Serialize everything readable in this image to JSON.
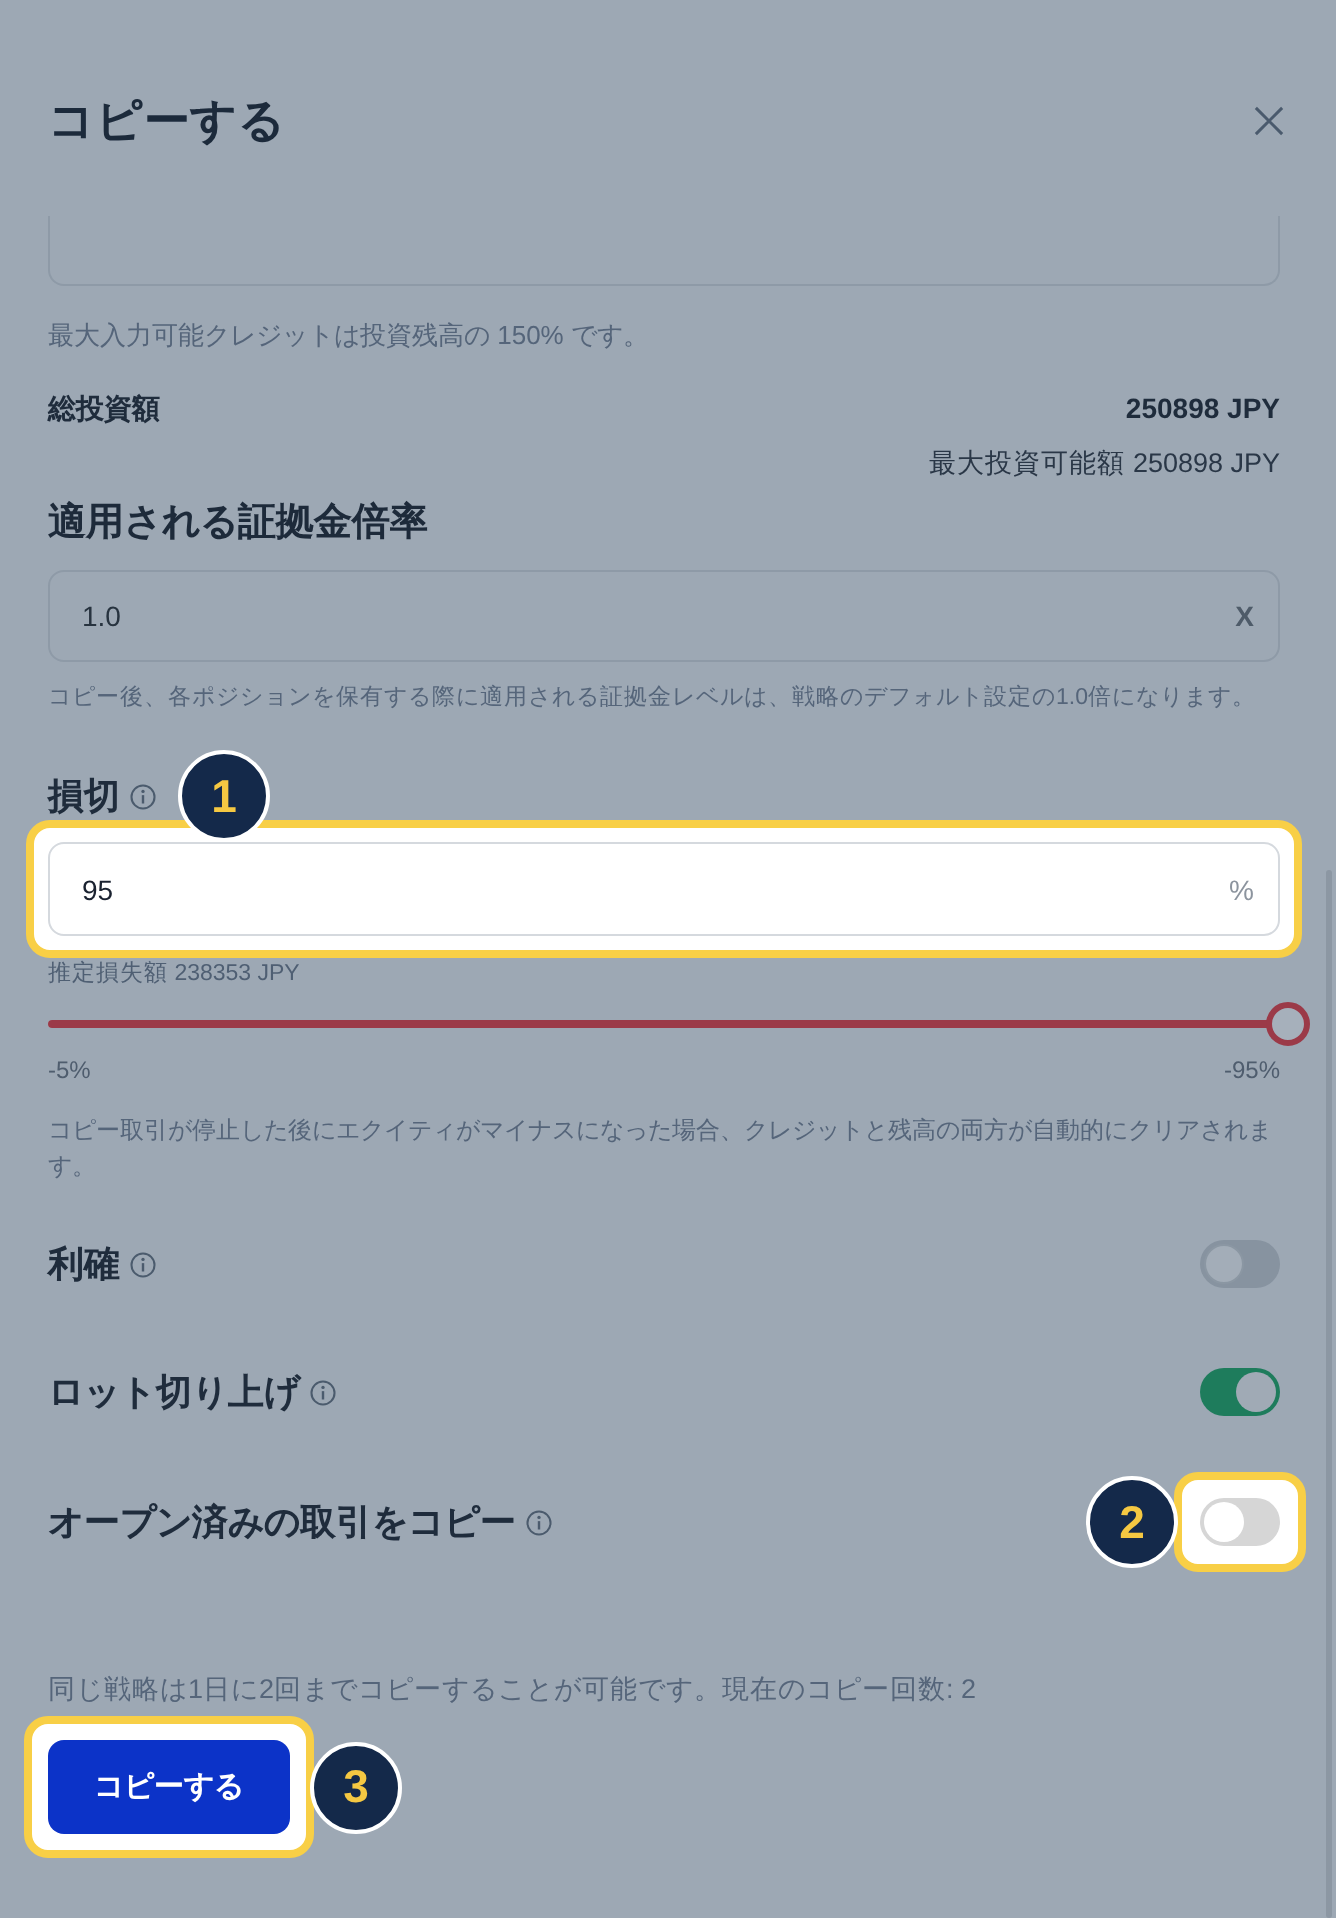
{
  "dialog": {
    "title": "コピーする"
  },
  "credit_note": "最大入力可能クレジットは投資残高の 150% です。",
  "total_investment": {
    "label": "総投資額",
    "value": "250898 JPY",
    "max_note": "最大投資可能額 250898 JPY"
  },
  "margin_rate": {
    "label": "適用される証拠金倍率",
    "value": "1.0",
    "suffix": "X",
    "hint": "コピー後、各ポジションを保有する際に適用される証拠金レベルは、戦略のデフォルト設定の1.0倍になります。"
  },
  "stop_loss": {
    "label": "損切",
    "value": "95",
    "suffix": "%",
    "highlighted": true,
    "callout": "1",
    "estimate": "推定損失額 238353 JPY",
    "slider": {
      "level": 1,
      "min_label": "-5%",
      "max_label": "-95%"
    },
    "note": "コピー取引が停止した後にエクイティがマイナスになった場合、クレジットと残高の両方が自動的にクリアされます。"
  },
  "toggles": [
    {
      "label": "利確",
      "on": false,
      "highlighted": false
    },
    {
      "label": "ロット切り上げ",
      "on": true,
      "highlighted": false
    },
    {
      "label": "オープン済みの取引をコピー",
      "on": false,
      "highlighted": true,
      "callout": "2"
    }
  ],
  "copy_limit_note": "同じ戦略は1日に2回までコピーすることが可能です。現在のコピー回数: 2",
  "copy_button": {
    "label": "コピーする",
    "highlighted": true,
    "callout": "3"
  }
}
